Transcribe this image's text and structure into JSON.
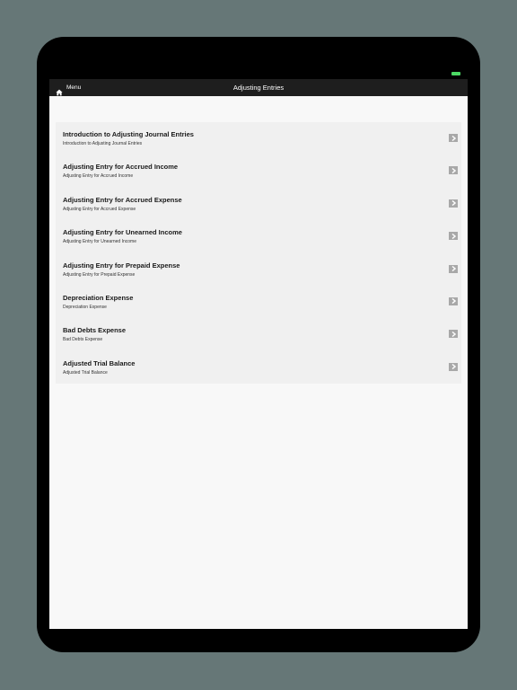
{
  "navbar": {
    "menu_label": "Menu",
    "title": "Adjusting Entries"
  },
  "colors": {
    "background": "#667777",
    "navbar": "#1e1e1e",
    "list_background": "#f0f0f0",
    "chevron_box": "#a8a8a8",
    "battery": "#4cd964"
  },
  "list": {
    "items": [
      {
        "title": "Introduction to Adjusting Journal Entries",
        "subtitle": "Introduction to Adjusting Journal Entries"
      },
      {
        "title": "Adjusting Entry for Accrued Income",
        "subtitle": "Adjusting Entry for Accrued Income"
      },
      {
        "title": "Adjusting Entry for Accrued Expense",
        "subtitle": "Adjusting Entry for Accrued Expense"
      },
      {
        "title": "Adjusting Entry for Unearned Income",
        "subtitle": "Adjusting Entry for Unearned Income"
      },
      {
        "title": "Adjusting Entry for Prepaid Expense",
        "subtitle": "Adjusting Entry for Prepaid Expense"
      },
      {
        "title": "Depreciation Expense",
        "subtitle": "Depreciation Expense"
      },
      {
        "title": "Bad Debts Expense",
        "subtitle": "Bad Debts Expense"
      },
      {
        "title": "Adjusted Trial Balance",
        "subtitle": "Adjusted Trial Balance"
      }
    ]
  }
}
